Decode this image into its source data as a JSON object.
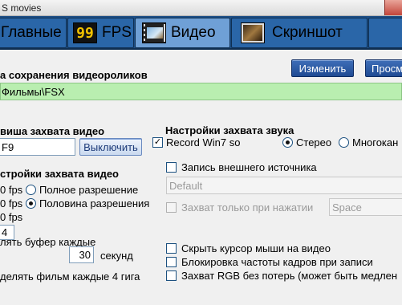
{
  "window": {
    "title": "S movies"
  },
  "tabs": [
    {
      "label": "Главные",
      "icon": "none",
      "active": false
    },
    {
      "label": "FPS",
      "icon": "fps-99-icon",
      "icon_text": "99",
      "active": false
    },
    {
      "label": "Видео",
      "icon": "film-icon",
      "active": true
    },
    {
      "label": "Скриншот",
      "icon": "screenshot-icon",
      "active": false
    }
  ],
  "save_folder": {
    "label": "а сохранения видеороликов",
    "path": "Фильмы\\FSX",
    "change_button": "Изменить",
    "view_button": "Просм"
  },
  "hotkey": {
    "label": "виша захвата видео",
    "value": "F9",
    "toggle_button": "Выключить"
  },
  "video_settings": {
    "label": "стройки захвата видео",
    "fps_options": [
      "0 fps",
      "0 fps",
      "0 fps"
    ],
    "resolution_options": [
      {
        "label": "Полное разрешение",
        "selected": false
      },
      {
        "label": "Половина разрешения",
        "selected": true
      }
    ],
    "input_value": "4",
    "buffer_label": "лять буфер каждые",
    "buffer_value": "30",
    "buffer_unit": "секунд",
    "split_label": "делять фильм каждые 4 гига"
  },
  "sound_settings": {
    "label": "Настройки захвата звука",
    "record_win7": {
      "label": "Record Win7 so",
      "checked": true
    },
    "channel_options": [
      {
        "label": "Стерео",
        "selected": true
      },
      {
        "label": "Многокан",
        "selected": false
      }
    ],
    "external_source": {
      "label": "Запись внешнего источника",
      "checked": false
    },
    "device_value": "Default",
    "press_to_capture": {
      "label": "Захват только при нажатии",
      "checked": false
    },
    "press_key_value": "Space"
  },
  "options": [
    {
      "label": "Скрыть курсор мыши на видео",
      "checked": false
    },
    {
      "label": "Блокировка частоты кадров при записи",
      "checked": false
    },
    {
      "label": "Захват RGB без потерь (может быть медлен",
      "checked": false
    }
  ],
  "colors": {
    "tabbar": "#1d4f86",
    "tab_active": "#6fa0d6",
    "path_bar": "#b9eeb0",
    "button": "#2a5aa6"
  }
}
